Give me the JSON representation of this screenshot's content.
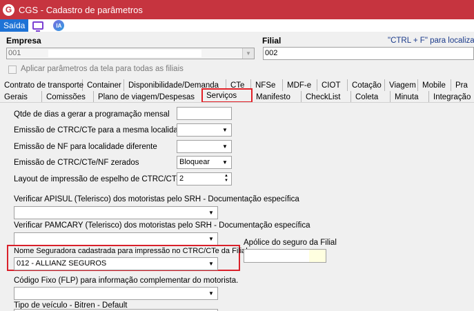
{
  "window": {
    "title": "CGS - Cadastro de parâmetros",
    "logo_letter": "G"
  },
  "toolbar": {
    "exit_label": "Saída",
    "ia_label": "IA"
  },
  "header": {
    "empresa_label": "Empresa",
    "empresa_value": "001",
    "filial_label": "Filial",
    "filial_value": "002",
    "search_hint": "\"CTRL + F\" para localizar",
    "apply_all_label": "Aplicar parâmetros da tela para todas as filiais"
  },
  "tabs_row1": [
    "Contrato de transporte",
    "Container",
    "Disponibilidade/Demanda",
    "CTe",
    "NFSe",
    "MDF-e",
    "CIOT",
    "Cotação",
    "Viagem",
    "Mobile",
    "Pra"
  ],
  "tabs_row2": [
    "Gerais",
    "Comissões",
    "Plano de viagem/Despesas",
    "Serviços",
    "Manifesto",
    "CheckList",
    "Coleta",
    "Minuta",
    "Integração"
  ],
  "active_tab": "Serviços",
  "form": {
    "qtde_dias_label": "Qtde de dias a gerar a programação mensal",
    "emissao_ctrc_label": "Emissão de CTRC/CTe para a mesma localidade",
    "emissao_nf_label": "Emissão de NF para localidade diferente",
    "emissao_zerados_label": "Emissão de CTRC/CTe/NF zerados",
    "emissao_zerados_value": "Bloquear",
    "layout_espelho_label": "Layout de impressão de espelho de CTRC/CT-e",
    "layout_espelho_value": "2",
    "apisul_label": "Verificar APISUL (Telerisco) dos motoristas pelo SRH - Documentação específica",
    "pamcary_label": "Verificar PAMCARY (Telerisco) dos motoristas pelo SRH - Documentação específica",
    "seguradora_label": "Nome Seguradora cadastrada para impressão no CTRC/CTe da Filial",
    "seguradora_value": "012 - ALLIANZ SEGUROS",
    "apolice_label": "Apólice do seguro da Filial",
    "codigo_fixo_label": "Código Fixo (FLP) para informação complementar do motorista.",
    "tipo_veiculo_label": "Tipo de veículo - Bitren - Default"
  },
  "colors": {
    "titlebar": "#c6343f",
    "exit_button": "#1e73d6",
    "highlight": "#d9202a"
  }
}
